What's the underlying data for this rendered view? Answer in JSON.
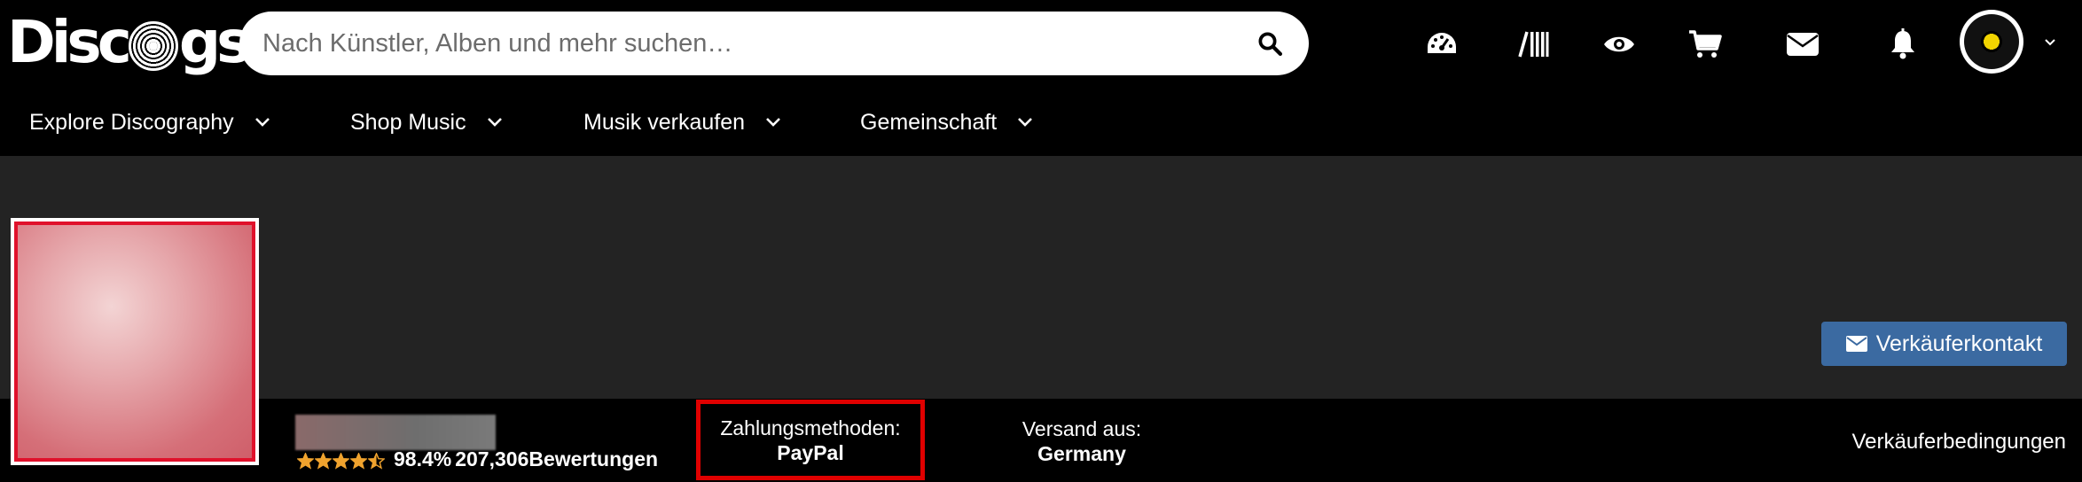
{
  "header": {
    "logo": "Discogs",
    "search_placeholder": "Nach Künstler, Alben und mehr suchen…",
    "icons": [
      "dashboard-icon",
      "collection-icon",
      "wantlist-icon",
      "cart-icon",
      "messages-icon",
      "notifications-icon"
    ]
  },
  "nav": {
    "items": [
      {
        "label": "Explore Discography"
      },
      {
        "label": "Shop Music"
      },
      {
        "label": "Musik verkaufen"
      },
      {
        "label": "Gemeinschaft"
      }
    ]
  },
  "seller": {
    "contact_button": "Verkäuferkontakt",
    "rating_stars": 4.5,
    "rating_percent": "98.4%",
    "rating_count": "207,306Bewertungen",
    "payment_label": "Zahlungsmethoden:",
    "payment_value": "PayPal",
    "shipping_label": "Versand aus:",
    "shipping_value": "Germany",
    "terms_link": "Verkäuferbedingungen"
  },
  "colors": {
    "accent_button": "#3b6aa1",
    "highlight_border": "#e00000",
    "avatar_border": "#e0112b",
    "star": "#f0a32e",
    "user_avatar_center": "#f2d400"
  }
}
